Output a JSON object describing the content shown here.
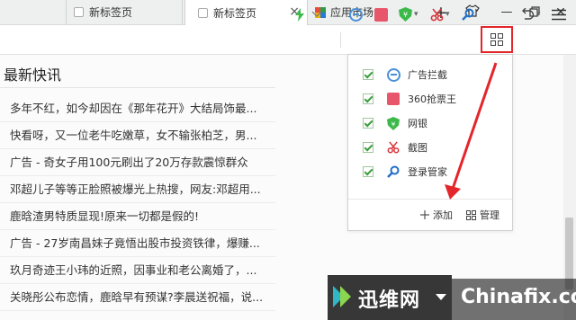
{
  "tabs": [
    {
      "label": "新标签页"
    },
    {
      "label": "新标签页"
    },
    {
      "label": "应用市场"
    }
  ],
  "window": {
    "new_tab": "+",
    "close_tab": "×",
    "minimize": "—",
    "close": "✕"
  },
  "news": {
    "heading": "最新快讯",
    "items": [
      "多年不红，如今却因在《那年花开》大结局饰最...",
      "快看呀，又一位老牛吃嫩草，女不输张柏芝，男...",
      "广告 - 奇女子用100元刷出了20万存款震惊群众",
      "邓超儿子等等正脸照被爆光上热搜，网友:邓超用...",
      "鹿晗渣男特质显现!原来一切都是假的!",
      "广告 - 27岁南昌妹子竟悟出股市投资铁律，爆赚...",
      "玖月奇迹王小玮的近照，因事业和老公离婚了，...",
      "关晓彤公布恋情，鹿晗早有预谋?李晨送祝福，说..."
    ]
  },
  "extensions_panel": {
    "items": [
      {
        "label": "广告拦截",
        "icon": "ad-block-icon",
        "checked": true,
        "color": "#4a90d9"
      },
      {
        "label": "360抢票王",
        "icon": "ticket-icon",
        "checked": true,
        "color": "#e8566c"
      },
      {
        "label": "网银",
        "icon": "yuan-shield-icon",
        "checked": true,
        "color": "#3cb94a"
      },
      {
        "label": "截图",
        "icon": "scissors-icon",
        "checked": true,
        "color": "#d9343a"
      },
      {
        "label": "登录管家",
        "icon": "key-icon",
        "checked": true,
        "color": "#1f6fc9"
      }
    ],
    "add_label": "添加",
    "manage_label": "管理"
  },
  "watermark": {
    "cn": "迅维网",
    "en": "Chinafix.com"
  },
  "colors": {
    "highlight": "#e3262b",
    "arrow": "#e3262b",
    "check": "#3a9d3a"
  }
}
